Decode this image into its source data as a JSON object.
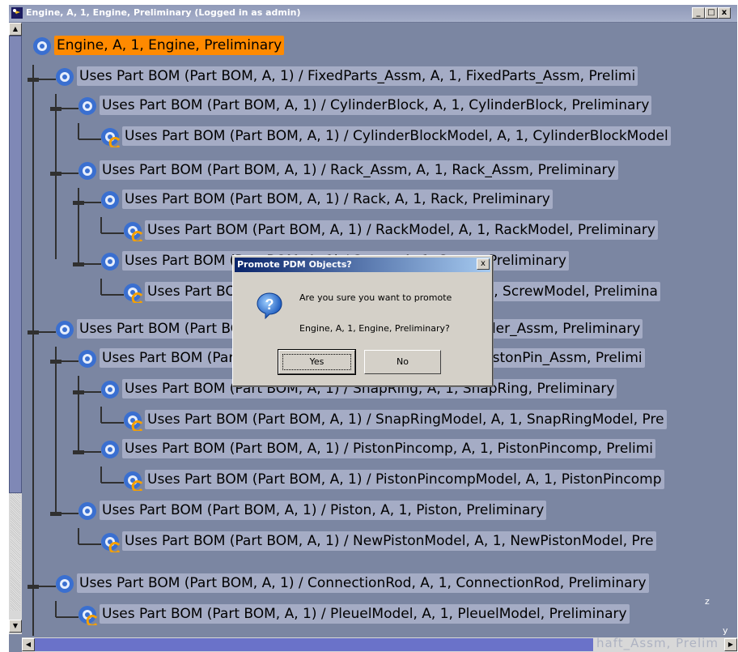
{
  "window": {
    "title": "Engine, A, 1, Engine, Preliminary (Logged in as admin)",
    "controls": [
      "_",
      "□",
      "x"
    ]
  },
  "tree": {
    "root": "Engine, A, 1, Engine, Preliminary",
    "rows": [
      {
        "text": "Uses Part BOM (Part BOM, A, 1) / FixedParts_Assm, A, 1, FixedParts_Assm, Prelimi"
      },
      {
        "text": "Uses Part BOM (Part BOM, A, 1) / CylinderBlock, A, 1, CylinderBlock, Preliminary"
      },
      {
        "text": "Uses Part BOM (Part BOM, A, 1) / CylinderBlockModel, A, 1, CylinderBlockModel"
      },
      {
        "text": "Uses Part BOM (Part BOM, A, 1) / Rack_Assm, A, 1, Rack_Assm, Preliminary"
      },
      {
        "text": "Uses Part BOM (Part BOM, A, 1) / Rack, A, 1, Rack, Preliminary"
      },
      {
        "text": "Uses Part BOM (Part BOM, A, 1) / RackModel, A, 1, RackModel, Preliminary"
      },
      {
        "text": "Uses Part BOM (Part BOM, A, 1) / Screw, A, 1, Screw, Preliminary"
      },
      {
        "text": "Uses Part BOM (Part BOM, A, 1) / ScrewModel, A, 1, ScrewModel, Prelimina"
      },
      {
        "text": "Uses Part BOM (Part BOM, A, 1) / Cylinder_Assm, A, 1, Cylinder_Assm, Preliminary"
      },
      {
        "text": "Uses Part BOM (Part BOM, A, 1) / PistonPin_Assm, A, 1, PistonPin_Assm, Prelimi"
      },
      {
        "text": "Uses Part BOM (Part BOM, A, 1) / SnapRing, A, 1, SnapRing, Preliminary"
      },
      {
        "text": "Uses Part BOM (Part BOM, A, 1) / SnapRingModel, A, 1, SnapRingModel, Pre"
      },
      {
        "text": "Uses Part BOM (Part BOM, A, 1) / PistonPincomp, A, 1, PistonPincomp, Prelimi"
      },
      {
        "text": "Uses Part BOM (Part BOM, A, 1) / PistonPincompModel, A, 1, PistonPincomp"
      },
      {
        "text": "Uses Part BOM (Part BOM, A, 1) / Piston, A, 1, Piston, Preliminary"
      },
      {
        "text": "Uses Part BOM (Part BOM, A, 1) / NewPistonModel, A, 1, NewPistonModel, Pre"
      },
      {
        "text": "Uses Part BOM (Part BOM, A, 1) / ConnectionRod, A, 1, ConnectionRod, Preliminary"
      },
      {
        "text": "Uses Part BOM (Part BOM, A, 1) / PleuelModel, A, 1, PleuelModel, Preliminary"
      }
    ]
  },
  "dialog": {
    "title": "Promote PDM Objects?",
    "message_line1": "Are you sure you want to promote",
    "message_line2": "Engine, A, 1, Engine, Preliminary?",
    "yes_label": "Yes",
    "no_label": "No",
    "close_glyph": "x"
  },
  "axis": {
    "z": "z",
    "y": "y"
  },
  "statusGhost": "haft_Assm, Prelim"
}
